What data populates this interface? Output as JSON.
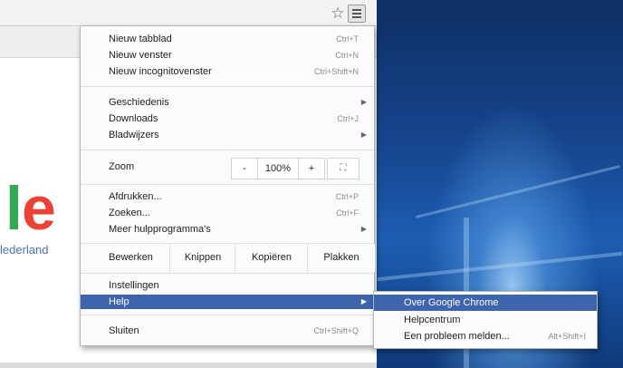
{
  "icons": {
    "star": "bookmark-star-icon",
    "menu": "hamburger-menu-icon",
    "fullscreen": "fullscreen-icon"
  },
  "page": {
    "logo_letter_green": "l",
    "logo_letter_red": "e",
    "logo_subtitle": "lederland"
  },
  "menu": {
    "new_tab": {
      "label": "Nieuw tabblad",
      "shortcut": "Ctrl+T"
    },
    "new_window": {
      "label": "Nieuw venster",
      "shortcut": "Ctrl+N"
    },
    "new_incognito": {
      "label": "Nieuw incognitovenster",
      "shortcut": "Ctrl+Shift+N"
    },
    "history": {
      "label": "Geschiedenis"
    },
    "downloads": {
      "label": "Downloads",
      "shortcut": "Ctrl+J"
    },
    "bookmarks": {
      "label": "Bladwijzers"
    },
    "zoom": {
      "label": "Zoom",
      "minus": "-",
      "value": "100%",
      "plus": "+"
    },
    "print": {
      "label": "Afdrukken...",
      "shortcut": "Ctrl+P"
    },
    "find": {
      "label": "Zoeken...",
      "shortcut": "Ctrl+F"
    },
    "more_tools": {
      "label": "Meer hulpprogramma's"
    },
    "edit": {
      "label": "Bewerken",
      "cut": "Knippen",
      "copy": "Kopiëren",
      "paste": "Plakken"
    },
    "settings": {
      "label": "Instellingen"
    },
    "help": {
      "label": "Help"
    },
    "exit": {
      "label": "Sluiten",
      "shortcut": "Ctrl+Shift+Q"
    }
  },
  "help_submenu": {
    "about": {
      "label": "Over Google Chrome"
    },
    "help_center": {
      "label": "Helpcentrum"
    },
    "report_issue": {
      "label": "Een probleem melden...",
      "shortcut": "Alt+Shift+I"
    }
  },
  "colors": {
    "highlight": "#3d64ad",
    "logo_green": "#34a853",
    "logo_red": "#ea4335"
  }
}
